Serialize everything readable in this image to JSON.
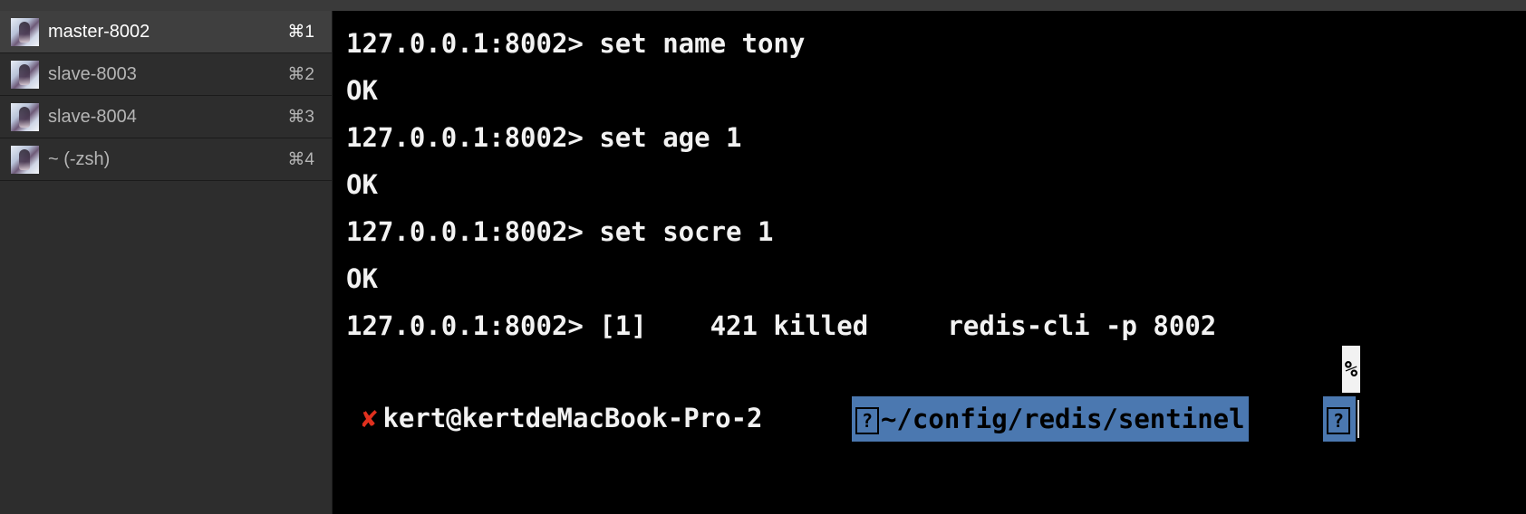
{
  "sidebar": {
    "tabs": [
      {
        "label": "master-8002",
        "shortcut": "⌘1",
        "active": true
      },
      {
        "label": "slave-8003",
        "shortcut": "⌘2",
        "active": false
      },
      {
        "label": "slave-8004",
        "shortcut": "⌘3",
        "active": false
      },
      {
        "label": "~ (-zsh)",
        "shortcut": "⌘4",
        "active": false
      }
    ]
  },
  "terminal": {
    "lines": [
      "127.0.0.1:8002> set name tony",
      "OK",
      "127.0.0.1:8002> set age 1",
      "OK",
      "127.0.0.1:8002> set socre 1",
      "OK",
      "127.0.0.1:8002> [1]    421 killed     redis-cli -p 8002"
    ],
    "percent_marker": "%",
    "prompt": {
      "status_symbol": "✘",
      "user_host": "kert@kertdeMacBook-Pro-2",
      "glyph": "?",
      "path": "~/config/redis/sentinel",
      "tail_glyph": "?"
    }
  },
  "colors": {
    "background": "#000000",
    "sidebar_bg": "#2d2d2d",
    "active_tab_bg": "#3f3f3f",
    "terminal_text": "#f2f2f2",
    "error_red": "#e0301e",
    "path_highlight": "#4b78b0"
  },
  "icons": {
    "tab_avatar": "avatar-image"
  }
}
